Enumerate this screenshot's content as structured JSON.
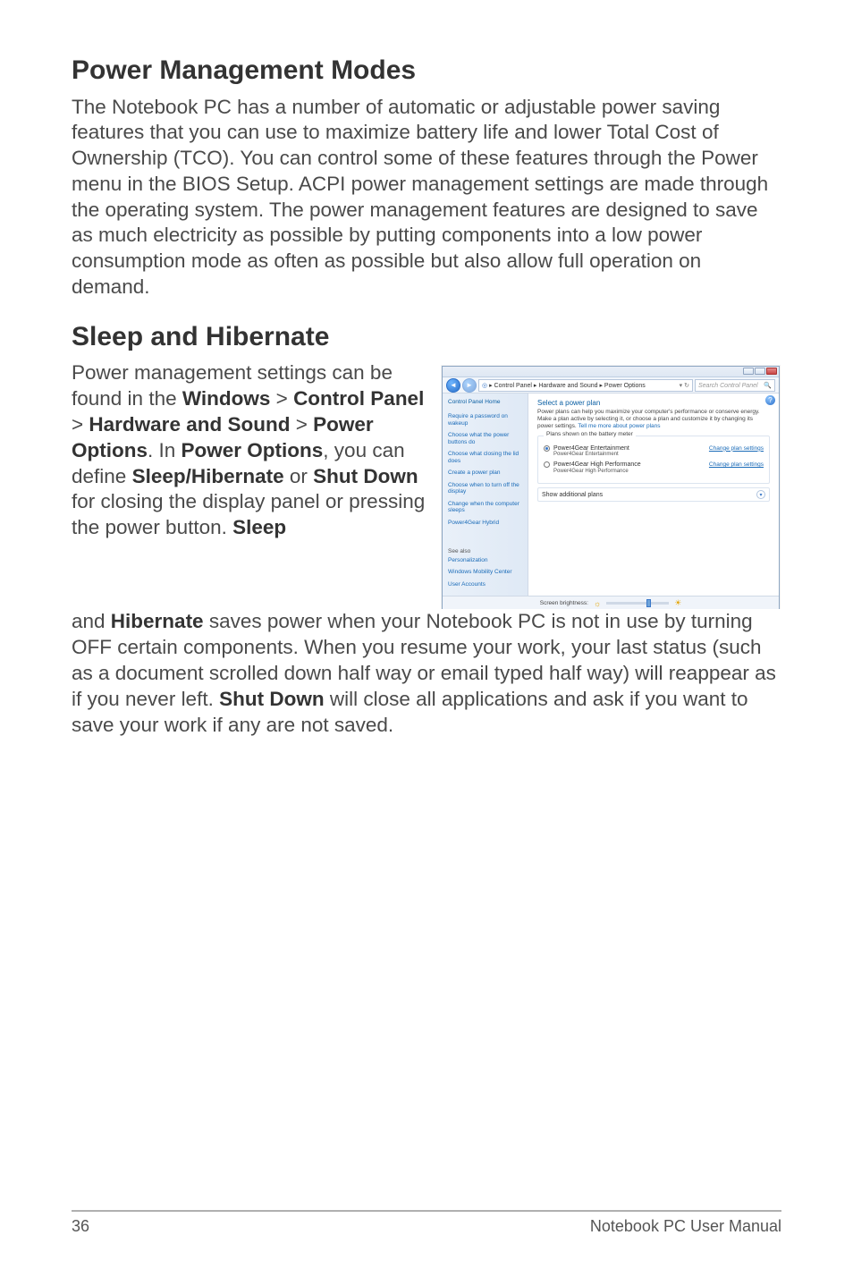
{
  "section1": {
    "heading": "Power Management Modes",
    "para": "The Notebook PC has a number of automatic or adjustable power saving features that you can use to maximize battery life and lower Total Cost of Ownership (TCO). You can control some of these features through the Power menu in the BIOS Setup. ACPI power management settings are made through the operating system. The power management features are designed to save as much electricity as possible by putting components into a low power consumption mode as often as possible but also allow full operation on demand."
  },
  "section2": {
    "heading": "Sleep and Hibernate",
    "left_parts": {
      "a": "Power management settings can be found in the ",
      "b": "Windows",
      "c": " > ",
      "d": "Control Panel",
      "e": " > ",
      "f": "Hardware and Sound",
      "g": " > ",
      "h": "Power Options",
      "i": ". In ",
      "j": "Power Options",
      "k": ", you can define ",
      "l": "Sleep/Hibernate",
      "m": " or ",
      "n": "Shut Down",
      "o": " for closing the display panel or pressing the power button. ",
      "p": "Sleep"
    },
    "cont_parts": {
      "a": "and ",
      "b": "Hibernate",
      "c": " saves power when your Notebook PC is not in use by turning OFF certain components. When you resume your work, your last status (such as a document scrolled down half way or email typed half way) will reappear as if you never left. ",
      "d": "Shut Down",
      "e": " will close all applications and ask if you want to save your work if any are not saved."
    }
  },
  "screenshot": {
    "breadcrumb": "▸ Control Panel ▸ Hardware and Sound ▸ Power Options",
    "search_placeholder": "Search Control Panel",
    "sidebar": {
      "home": "Control Panel Home",
      "links": [
        "Require a password on wakeup",
        "Choose what the power buttons do",
        "Choose what closing the lid does",
        "Create a power plan",
        "Choose when to turn off the display",
        "Change when the computer sleeps",
        "Power4Gear Hybrid"
      ],
      "see_also_label": "See also",
      "see_also": [
        "Personalization",
        "Windows Mobility Center",
        "User Accounts"
      ]
    },
    "main": {
      "title": "Select a power plan",
      "desc_a": "Power plans can help you maximize your computer's performance or conserve energy. Make a plan active by selecting it, or choose a plan and customize it by changing its power settings. ",
      "desc_link": "Tell me more about power plans",
      "group_legend": "Plans shown on the battery meter",
      "plan1_name": "Power4Gear Entertainment",
      "plan1_sub": "Power4Gear Entertainment",
      "plan2_name": "Power4Gear High Performance",
      "plan2_sub": "Power4Gear High Performance",
      "change_settings": "Change plan settings",
      "show_additional": "Show additional plans"
    },
    "bottom": {
      "label": "Screen brightness:"
    }
  },
  "footer": {
    "page": "36",
    "title": "Notebook PC User Manual"
  }
}
